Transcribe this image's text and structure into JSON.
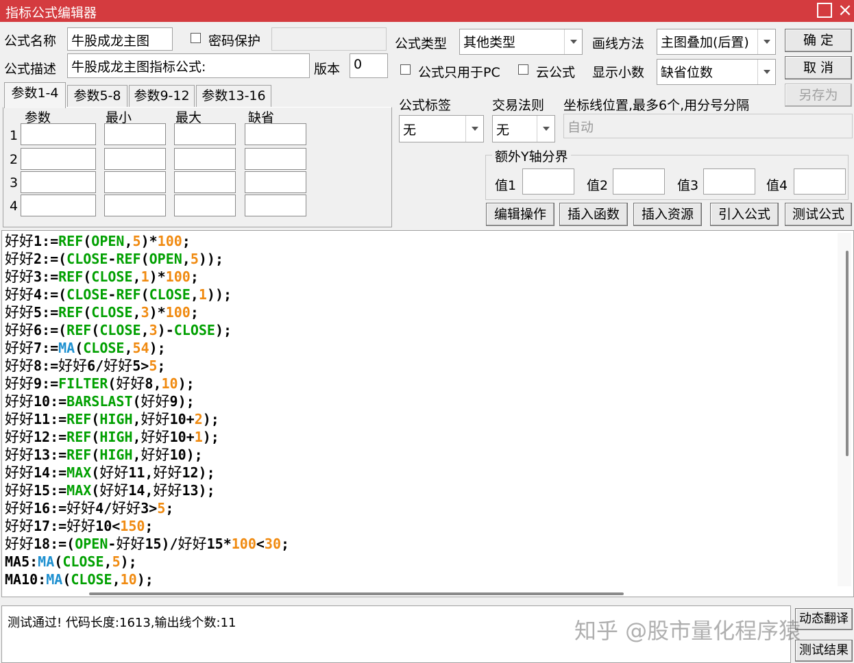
{
  "window": {
    "title": "指标公式编辑器",
    "close": "×"
  },
  "form": {
    "name_label": "公式名称",
    "name_value": "牛股成龙主图",
    "password_label": "密码保护",
    "desc_label": "公式描述",
    "desc_value": "牛股成龙主图指标公式:",
    "version_label": "版本",
    "version_value": "0",
    "type_label": "公式类型",
    "type_value": "其他类型",
    "draw_label": "画线方法",
    "draw_value": "主图叠加(后置)",
    "pc_only_label": "公式只用于PC",
    "cloud_label": "云公式",
    "decimals_label": "显示小数",
    "decimals_value": "缺省位数",
    "tag_label": "公式标签",
    "tag_value": "无",
    "trade_label": "交易法则",
    "trade_value": "无",
    "coord_label": "坐标线位置,最多6个,用分号分隔",
    "coord_value": "自动",
    "yaxis_label": "额外Y轴分界",
    "y_values": [
      "值1",
      "值2",
      "值3",
      "值4"
    ]
  },
  "buttons": {
    "ok": "确  定",
    "cancel": "取  消",
    "save_as": "另存为",
    "edit": "编辑操作",
    "insert_func": "插入函数",
    "insert_res": "插入资源",
    "import": "引入公式",
    "test": "测试公式",
    "translate": "动态翻译",
    "result": "测试结果"
  },
  "tabs": [
    "参数1-4",
    "参数5-8",
    "参数9-12",
    "参数13-16"
  ],
  "params": {
    "headers": [
      "参数",
      "最小",
      "最大",
      "缺省"
    ],
    "rows": [
      "1",
      "2",
      "3",
      "4"
    ]
  },
  "code_lines": [
    [
      [
        "cn",
        "好好"
      ],
      [
        "t",
        "1:="
      ],
      [
        "kw",
        "REF"
      ],
      [
        "t",
        "("
      ],
      [
        "kw",
        "OPEN"
      ],
      [
        "t",
        ","
      ],
      [
        "num",
        "5"
      ],
      [
        "t",
        ")*"
      ],
      [
        "num",
        "100"
      ],
      [
        "t",
        ";"
      ]
    ],
    [
      [
        "cn",
        "好好"
      ],
      [
        "t",
        "2:=("
      ],
      [
        "kw",
        "CLOSE"
      ],
      [
        "t",
        "-"
      ],
      [
        "kw",
        "REF"
      ],
      [
        "t",
        "("
      ],
      [
        "kw",
        "OPEN"
      ],
      [
        "t",
        ","
      ],
      [
        "num",
        "5"
      ],
      [
        "t",
        "));"
      ]
    ],
    [
      [
        "cn",
        "好好"
      ],
      [
        "t",
        "3:="
      ],
      [
        "kw",
        "REF"
      ],
      [
        "t",
        "("
      ],
      [
        "kw",
        "CLOSE"
      ],
      [
        "t",
        ","
      ],
      [
        "num",
        "1"
      ],
      [
        "t",
        ")*"
      ],
      [
        "num",
        "100"
      ],
      [
        "t",
        ";"
      ]
    ],
    [
      [
        "cn",
        "好好"
      ],
      [
        "t",
        "4:=("
      ],
      [
        "kw",
        "CLOSE"
      ],
      [
        "t",
        "-"
      ],
      [
        "kw",
        "REF"
      ],
      [
        "t",
        "("
      ],
      [
        "kw",
        "CLOSE"
      ],
      [
        "t",
        ","
      ],
      [
        "num",
        "1"
      ],
      [
        "t",
        "));"
      ]
    ],
    [
      [
        "cn",
        "好好"
      ],
      [
        "t",
        "5:="
      ],
      [
        "kw",
        "REF"
      ],
      [
        "t",
        "("
      ],
      [
        "kw",
        "CLOSE"
      ],
      [
        "t",
        ","
      ],
      [
        "num",
        "3"
      ],
      [
        "t",
        ")*"
      ],
      [
        "num",
        "100"
      ],
      [
        "t",
        ";"
      ]
    ],
    [
      [
        "cn",
        "好好"
      ],
      [
        "t",
        "6:=("
      ],
      [
        "kw",
        "REF"
      ],
      [
        "t",
        "("
      ],
      [
        "kw",
        "CLOSE"
      ],
      [
        "t",
        ","
      ],
      [
        "num",
        "3"
      ],
      [
        "t",
        ")-"
      ],
      [
        "kw",
        "CLOSE"
      ],
      [
        "t",
        ");"
      ]
    ],
    [
      [
        "cn",
        "好好"
      ],
      [
        "t",
        "7:="
      ],
      [
        "fn",
        "MA"
      ],
      [
        "t",
        "("
      ],
      [
        "kw",
        "CLOSE"
      ],
      [
        "t",
        ","
      ],
      [
        "num",
        "54"
      ],
      [
        "t",
        ");"
      ]
    ],
    [
      [
        "cn",
        "好好"
      ],
      [
        "t",
        "8:="
      ],
      [
        "cn",
        "好好"
      ],
      [
        "t",
        "6/"
      ],
      [
        "cn",
        "好好"
      ],
      [
        "t",
        "5>"
      ],
      [
        "num",
        "5"
      ],
      [
        "t",
        ";"
      ]
    ],
    [
      [
        "cn",
        "好好"
      ],
      [
        "t",
        "9:="
      ],
      [
        "kw",
        "FILTER"
      ],
      [
        "t",
        "("
      ],
      [
        "cn",
        "好好"
      ],
      [
        "t",
        "8,"
      ],
      [
        "num",
        "10"
      ],
      [
        "t",
        ");"
      ]
    ],
    [
      [
        "cn",
        "好好"
      ],
      [
        "t",
        "10:="
      ],
      [
        "kw",
        "BARSLAST"
      ],
      [
        "t",
        "("
      ],
      [
        "cn",
        "好好"
      ],
      [
        "t",
        "9);"
      ]
    ],
    [
      [
        "cn",
        "好好"
      ],
      [
        "t",
        "11:="
      ],
      [
        "kw",
        "REF"
      ],
      [
        "t",
        "("
      ],
      [
        "kw",
        "HIGH"
      ],
      [
        "t",
        ","
      ],
      [
        "cn",
        "好好"
      ],
      [
        "t",
        "10+"
      ],
      [
        "num",
        "2"
      ],
      [
        "t",
        ");"
      ]
    ],
    [
      [
        "cn",
        "好好"
      ],
      [
        "t",
        "12:="
      ],
      [
        "kw",
        "REF"
      ],
      [
        "t",
        "("
      ],
      [
        "kw",
        "HIGH"
      ],
      [
        "t",
        ","
      ],
      [
        "cn",
        "好好"
      ],
      [
        "t",
        "10+"
      ],
      [
        "num",
        "1"
      ],
      [
        "t",
        ");"
      ]
    ],
    [
      [
        "cn",
        "好好"
      ],
      [
        "t",
        "13:="
      ],
      [
        "kw",
        "REF"
      ],
      [
        "t",
        "("
      ],
      [
        "kw",
        "HIGH"
      ],
      [
        "t",
        ","
      ],
      [
        "cn",
        "好好"
      ],
      [
        "t",
        "10);"
      ]
    ],
    [
      [
        "cn",
        "好好"
      ],
      [
        "t",
        "14:="
      ],
      [
        "kw",
        "MAX"
      ],
      [
        "t",
        "("
      ],
      [
        "cn",
        "好好"
      ],
      [
        "t",
        "11,"
      ],
      [
        "cn",
        "好好"
      ],
      [
        "t",
        "12);"
      ]
    ],
    [
      [
        "cn",
        "好好"
      ],
      [
        "t",
        "15:="
      ],
      [
        "kw",
        "MAX"
      ],
      [
        "t",
        "("
      ],
      [
        "cn",
        "好好"
      ],
      [
        "t",
        "14,"
      ],
      [
        "cn",
        "好好"
      ],
      [
        "t",
        "13);"
      ]
    ],
    [
      [
        "cn",
        "好好"
      ],
      [
        "t",
        "16:="
      ],
      [
        "cn",
        "好好"
      ],
      [
        "t",
        "4/"
      ],
      [
        "cn",
        "好好"
      ],
      [
        "t",
        "3>"
      ],
      [
        "num",
        "5"
      ],
      [
        "t",
        ";"
      ]
    ],
    [
      [
        "cn",
        "好好"
      ],
      [
        "t",
        "17:="
      ],
      [
        "cn",
        "好好"
      ],
      [
        "t",
        "10<"
      ],
      [
        "num",
        "150"
      ],
      [
        "t",
        ";"
      ]
    ],
    [
      [
        "cn",
        "好好"
      ],
      [
        "t",
        "18:=("
      ],
      [
        "kw",
        "OPEN"
      ],
      [
        "t",
        "-"
      ],
      [
        "cn",
        "好好"
      ],
      [
        "t",
        "15)/"
      ],
      [
        "cn",
        "好好"
      ],
      [
        "t",
        "15*"
      ],
      [
        "num",
        "100"
      ],
      [
        "t",
        "<"
      ],
      [
        "num",
        "30"
      ],
      [
        "t",
        ";"
      ]
    ],
    [
      [
        "t",
        "MA5:"
      ],
      [
        "fn",
        "MA"
      ],
      [
        "t",
        "("
      ],
      [
        "kw",
        "CLOSE"
      ],
      [
        "t",
        ","
      ],
      [
        "num",
        "5"
      ],
      [
        "t",
        ");"
      ]
    ],
    [
      [
        "t",
        "MA10:"
      ],
      [
        "fn",
        "MA"
      ],
      [
        "t",
        "("
      ],
      [
        "kw",
        "CLOSE"
      ],
      [
        "t",
        ","
      ],
      [
        "num",
        "10"
      ],
      [
        "t",
        ");"
      ]
    ]
  ],
  "output": {
    "message": "测试通过! 代码长度:1613,输出线个数:11"
  },
  "watermark": "知乎 @股市量化程序猿"
}
